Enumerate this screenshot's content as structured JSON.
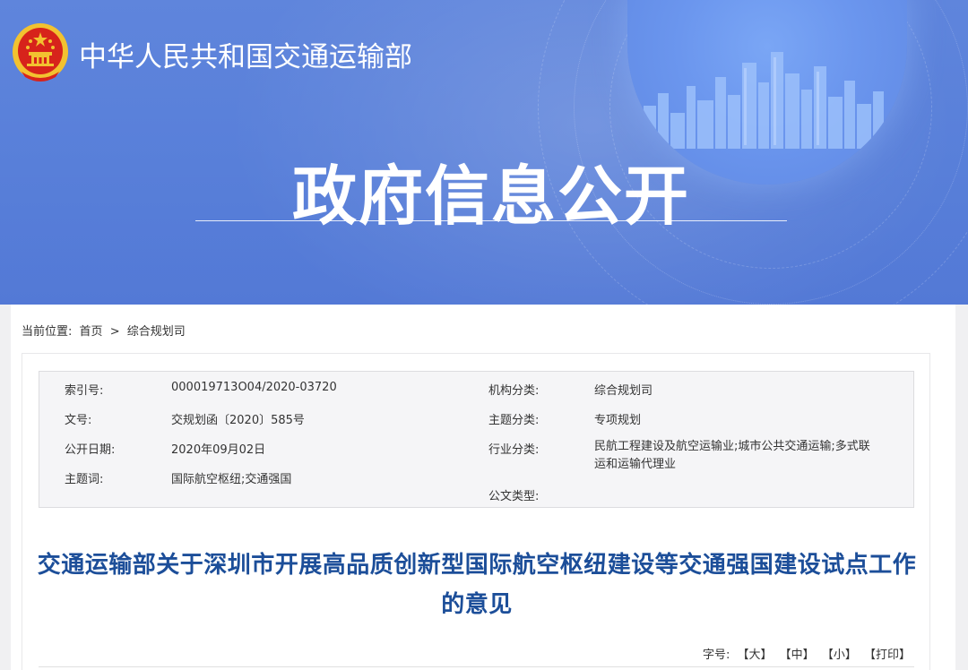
{
  "header": {
    "ministry_name": "中华人民共和国交通运输部",
    "banner_title": "政府信息公开",
    "emblem_icon": "national-emblem-icon"
  },
  "breadcrumb": {
    "label": "当前位置:",
    "home": "首页",
    "separator": ">",
    "current": "综合规划司"
  },
  "meta": {
    "index_no_label": "索引号:",
    "index_no": "000019713O04/2020-03720",
    "doc_no_label": "文号:",
    "doc_no": "交规划函〔2020〕585号",
    "pub_date_label": "公开日期:",
    "pub_date": "2020年09月02日",
    "keywords_label": "主题词:",
    "keywords": "国际航空枢纽;交通强国",
    "org_label": "机构分类:",
    "org": "综合规划司",
    "topic_label": "主题分类:",
    "topic": "专项规划",
    "industry_label": "行业分类:",
    "industry": "民航工程建设及航空运输业;城市公共交通运输;多式联运和运输代理业",
    "doctype_label": "公文类型:",
    "doctype": ""
  },
  "document": {
    "title": "交通运输部关于深圳市开展高品质创新型国际航空枢纽建设等交通强国建设试点工作的意见"
  },
  "font_controls": {
    "label": "字号:",
    "large": "【大】",
    "medium": "【中】",
    "small": "【小】",
    "print": "【打印】"
  },
  "colors": {
    "banner_blue": "#587fd9",
    "title_blue": "#1c4e99",
    "emblem_red": "#d7231b",
    "emblem_gold": "#f2c230"
  }
}
